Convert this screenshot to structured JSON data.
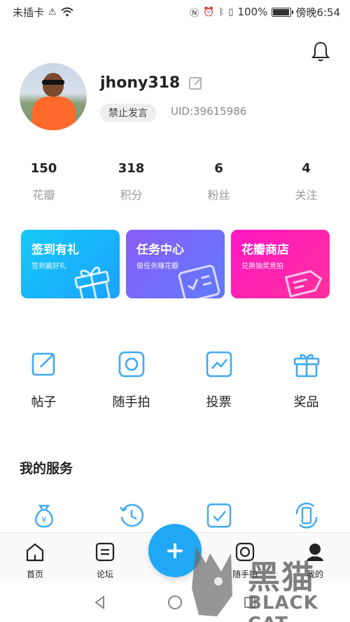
{
  "status_bar": {
    "carrier": "未插卡",
    "battery_text": "100%",
    "battery_level": 1.0,
    "time": "傍晚6:54"
  },
  "profile": {
    "username": "jhony318",
    "badge": "禁止发言",
    "uid": "UID:39615986"
  },
  "stats": [
    {
      "value": "150",
      "label": "花瓣"
    },
    {
      "value": "318",
      "label": "积分"
    },
    {
      "value": "6",
      "label": "粉丝"
    },
    {
      "value": "4",
      "label": "关注"
    }
  ],
  "cards": [
    {
      "title": "签到有礼",
      "subtitle": "签到赢好礼",
      "color_from": "#17c9f7",
      "color_to": "#1aa2ff"
    },
    {
      "title": "任务中心",
      "subtitle": "做任务赚花瓣",
      "color_from": "#8a5cf6",
      "color_to": "#5f7bff"
    },
    {
      "title": "花瓣商店",
      "subtitle": "兑换抽奖竞拍",
      "color_from": "#ff19c4",
      "color_to": "#ff2f9c"
    }
  ],
  "quick_links": [
    {
      "label": "帖子",
      "icon": "edit-square-icon"
    },
    {
      "label": "随手拍",
      "icon": "camera-icon"
    },
    {
      "label": "投票",
      "icon": "chart-icon"
    },
    {
      "label": "奖品",
      "icon": "gift-icon"
    }
  ],
  "services": {
    "title": "我的服务",
    "icons": [
      "money-bag-icon",
      "history-clock-icon",
      "checklist-icon",
      "phone-sync-icon"
    ]
  },
  "bottom_nav": [
    {
      "label": "首页",
      "icon": "home-icon"
    },
    {
      "label": "论坛",
      "icon": "forum-icon"
    },
    {
      "label": "",
      "icon": "plus-icon"
    },
    {
      "label": "随手拍",
      "icon": "camera-icon"
    },
    {
      "label": "我的",
      "icon": "profile-icon"
    }
  ],
  "fab": {
    "symbol": "+"
  },
  "watermark": {
    "big": "黑猫",
    "small": "BLACK CAT"
  },
  "colors": {
    "accent": "#20a8f4",
    "icon_blue": "#3fa9f5"
  }
}
